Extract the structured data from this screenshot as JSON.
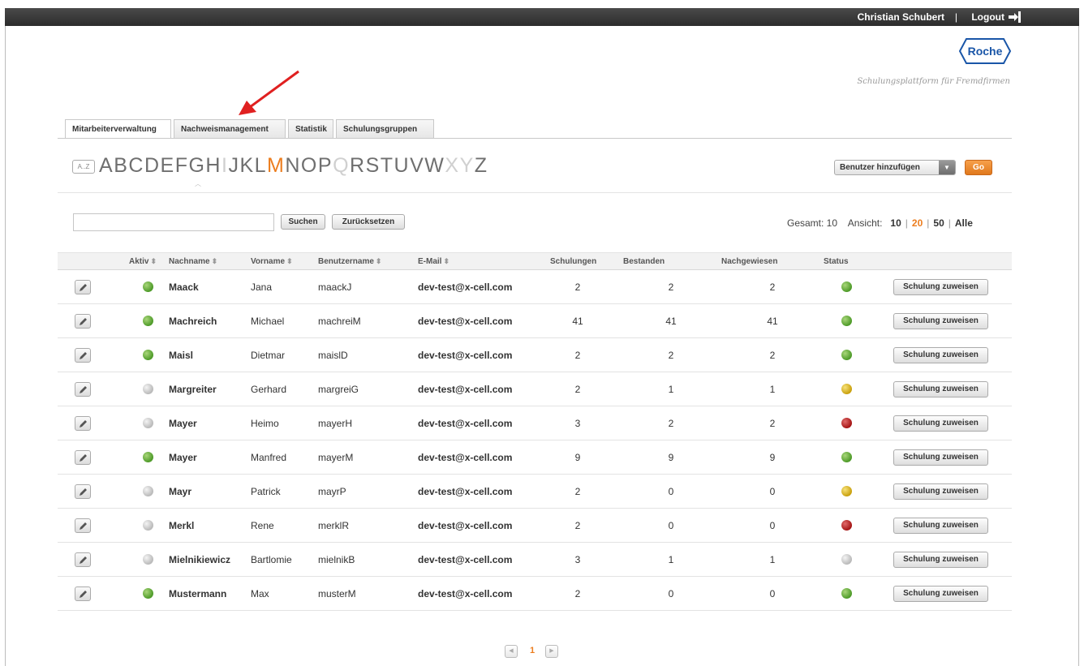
{
  "header": {
    "user_name": "Christian Schubert",
    "separator": "|",
    "logout_label": "Logout"
  },
  "brand": {
    "logo_text": "Roche",
    "tagline": "Schulungsplattform für Fremdfirmen"
  },
  "tabs": [
    {
      "label": "Mitarbeiterverwaltung",
      "active": true
    },
    {
      "label": "Nachweismanagement",
      "active": false
    },
    {
      "label": "Statistik",
      "active": false
    },
    {
      "label": "Schulungsgruppen",
      "active": false
    }
  ],
  "alphabet": {
    "az_label": "A..Z",
    "letters": [
      "A",
      "B",
      "C",
      "D",
      "E",
      "F",
      "G",
      "H",
      "I",
      "J",
      "K",
      "L",
      "M",
      "N",
      "O",
      "P",
      "Q",
      "R",
      "S",
      "T",
      "U",
      "V",
      "W",
      "X",
      "Y",
      "Z"
    ],
    "disabled": [
      "I",
      "Q",
      "X",
      "Y"
    ],
    "active": "M"
  },
  "actions": {
    "select_value": "Benutzer hinzufügen",
    "go_label": "Go"
  },
  "search": {
    "value": "",
    "search_label": "Suchen",
    "reset_label": "Zurücksetzen"
  },
  "pager": {
    "total_label": "Gesamt: 10",
    "view_label": "Ansicht:",
    "options": [
      "10",
      "20",
      "50",
      "Alle"
    ],
    "active_option": "20",
    "current_page": "1"
  },
  "table": {
    "headers": {
      "aktiv": "Aktiv",
      "nachname": "Nachname",
      "vorname": "Vorname",
      "benutzername": "Benutzername",
      "email": "E-Mail",
      "schulungen": "Schulungen",
      "bestanden": "Bestanden",
      "nachgewiesen": "Nachgewiesen",
      "status": "Status"
    },
    "action_label": "Schulung zuweisen",
    "rows": [
      {
        "active": "green",
        "nachname": "Maack",
        "vorname": "Jana",
        "benutzername": "maackJ",
        "email": "dev-test@x-cell.com",
        "schulungen": "2",
        "bestanden": "2",
        "nachgewiesen": "2",
        "status": "green"
      },
      {
        "active": "green",
        "nachname": "Machreich",
        "vorname": "Michael",
        "benutzername": "machreiM",
        "email": "dev-test@x-cell.com",
        "schulungen": "41",
        "bestanden": "41",
        "nachgewiesen": "41",
        "status": "green"
      },
      {
        "active": "green",
        "nachname": "Maisl",
        "vorname": "Dietmar",
        "benutzername": "maislD",
        "email": "dev-test@x-cell.com",
        "schulungen": "2",
        "bestanden": "2",
        "nachgewiesen": "2",
        "status": "green"
      },
      {
        "active": "grey",
        "nachname": "Margreiter",
        "vorname": "Gerhard",
        "benutzername": "margreiG",
        "email": "dev-test@x-cell.com",
        "schulungen": "2",
        "bestanden": "1",
        "nachgewiesen": "1",
        "status": "yellow"
      },
      {
        "active": "grey",
        "nachname": "Mayer",
        "vorname": "Heimo",
        "benutzername": "mayerH",
        "email": "dev-test@x-cell.com",
        "schulungen": "3",
        "bestanden": "2",
        "nachgewiesen": "2",
        "status": "red"
      },
      {
        "active": "green",
        "nachname": "Mayer",
        "vorname": "Manfred",
        "benutzername": "mayerM",
        "email": "dev-test@x-cell.com",
        "schulungen": "9",
        "bestanden": "9",
        "nachgewiesen": "9",
        "status": "green"
      },
      {
        "active": "grey",
        "nachname": "Mayr",
        "vorname": "Patrick",
        "benutzername": "mayrP",
        "email": "dev-test@x-cell.com",
        "schulungen": "2",
        "bestanden": "0",
        "nachgewiesen": "0",
        "status": "yellow"
      },
      {
        "active": "grey",
        "nachname": "Merkl",
        "vorname": "Rene",
        "benutzername": "merklR",
        "email": "dev-test@x-cell.com",
        "schulungen": "2",
        "bestanden": "0",
        "nachgewiesen": "0",
        "status": "red"
      },
      {
        "active": "grey",
        "nachname": "Mielnikiewicz",
        "vorname": "Bartlomie",
        "benutzername": "mielnikB",
        "email": "dev-test@x-cell.com",
        "schulungen": "3",
        "bestanden": "1",
        "nachgewiesen": "1",
        "status": "grey"
      },
      {
        "active": "green",
        "nachname": "Mustermann",
        "vorname": "Max",
        "benutzername": "musterM",
        "email": "dev-test@x-cell.com",
        "schulungen": "2",
        "bestanden": "0",
        "nachgewiesen": "0",
        "status": "green"
      }
    ]
  },
  "colors": {
    "accent": "#ec7d1e",
    "topbar": "#333333",
    "roche_blue": "#1a56a8",
    "annotation_arrow": "#e02020"
  },
  "icons": {
    "logout": "logout-arrow-icon",
    "edit": "pencil-icon",
    "sort": "sort-arrows-icon"
  }
}
